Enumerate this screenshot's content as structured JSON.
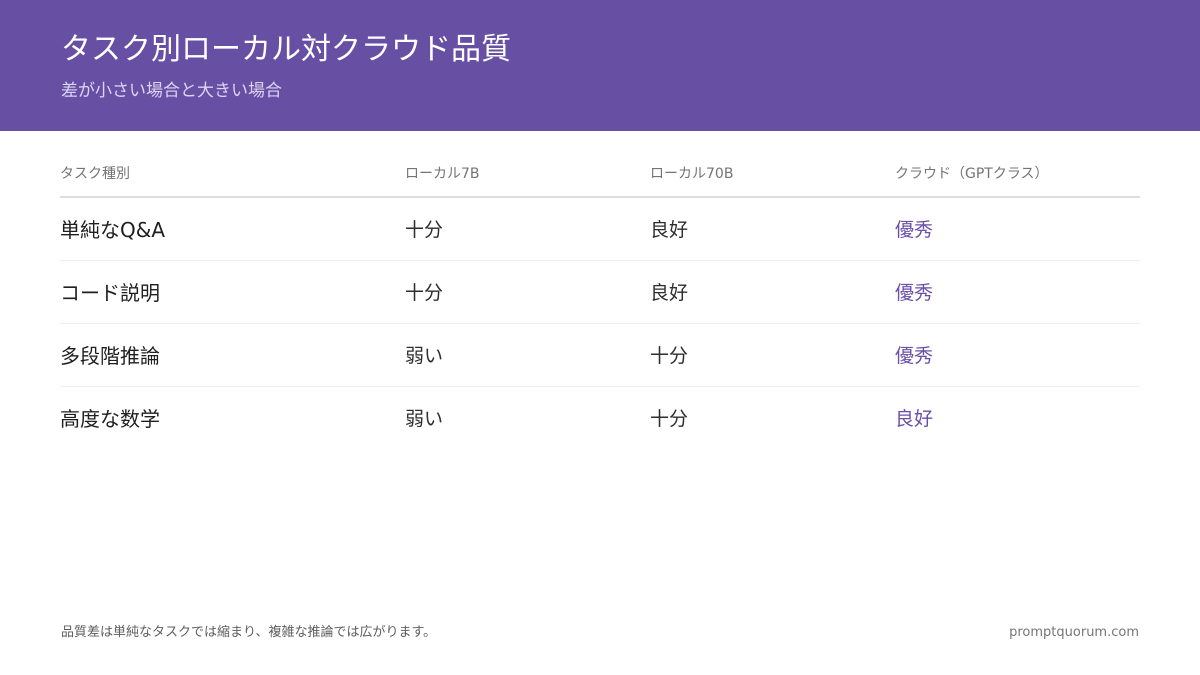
{
  "header": {
    "title": "タスク別ローカル対クラウド品質",
    "subtitle": "差が小さい場合と大きい場合"
  },
  "table": {
    "columns": [
      "タスク種別",
      "ローカル7B",
      "ローカル70B",
      "クラウド（GPTクラス）"
    ],
    "rows": [
      [
        "単純なQ&A",
        "十分",
        "良好",
        "優秀"
      ],
      [
        "コード説明",
        "十分",
        "良好",
        "優秀"
      ],
      [
        "多段階推論",
        "弱い",
        "十分",
        "優秀"
      ],
      [
        "高度な数学",
        "弱い",
        "十分",
        "良好"
      ]
    ]
  },
  "footer": {
    "note": "品質差は単純なタスクでは縮まり、複雑な推論では広がります。",
    "site": "promptquorum.com"
  },
  "colors": {
    "header_bg": "#6750a4",
    "accent": "#6a4fa8"
  }
}
